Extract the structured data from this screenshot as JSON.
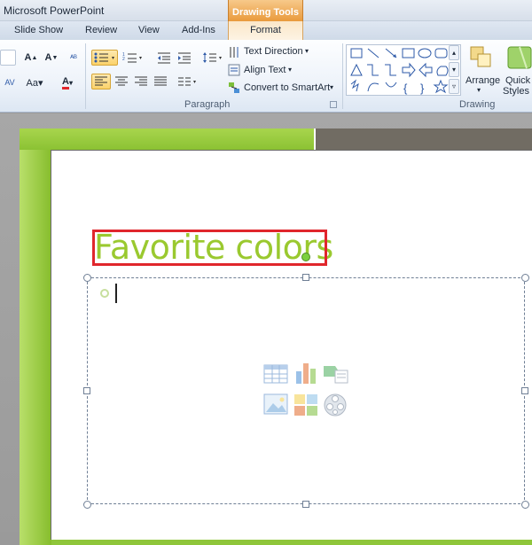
{
  "app": {
    "title": "Microsoft PowerPoint"
  },
  "contextual_tab": {
    "header": "Drawing Tools",
    "tab": "Format"
  },
  "tabs": [
    {
      "label": "Slide Show"
    },
    {
      "label": "Review"
    },
    {
      "label": "View"
    },
    {
      "label": "Add-Ins"
    }
  ],
  "ribbon": {
    "paragraph": {
      "label": "Paragraph",
      "text_direction": "Text Direction",
      "align_text": "Align Text",
      "convert_smartart": "Convert to SmartArt"
    },
    "drawing": {
      "label": "Drawing",
      "arrange": "Arrange",
      "quick_styles_1": "Quick",
      "quick_styles_2": "Styles"
    }
  },
  "slide": {
    "title": "Favorite colors",
    "accent_color": "#9ac92f",
    "highlight_color": "#e0262c"
  }
}
